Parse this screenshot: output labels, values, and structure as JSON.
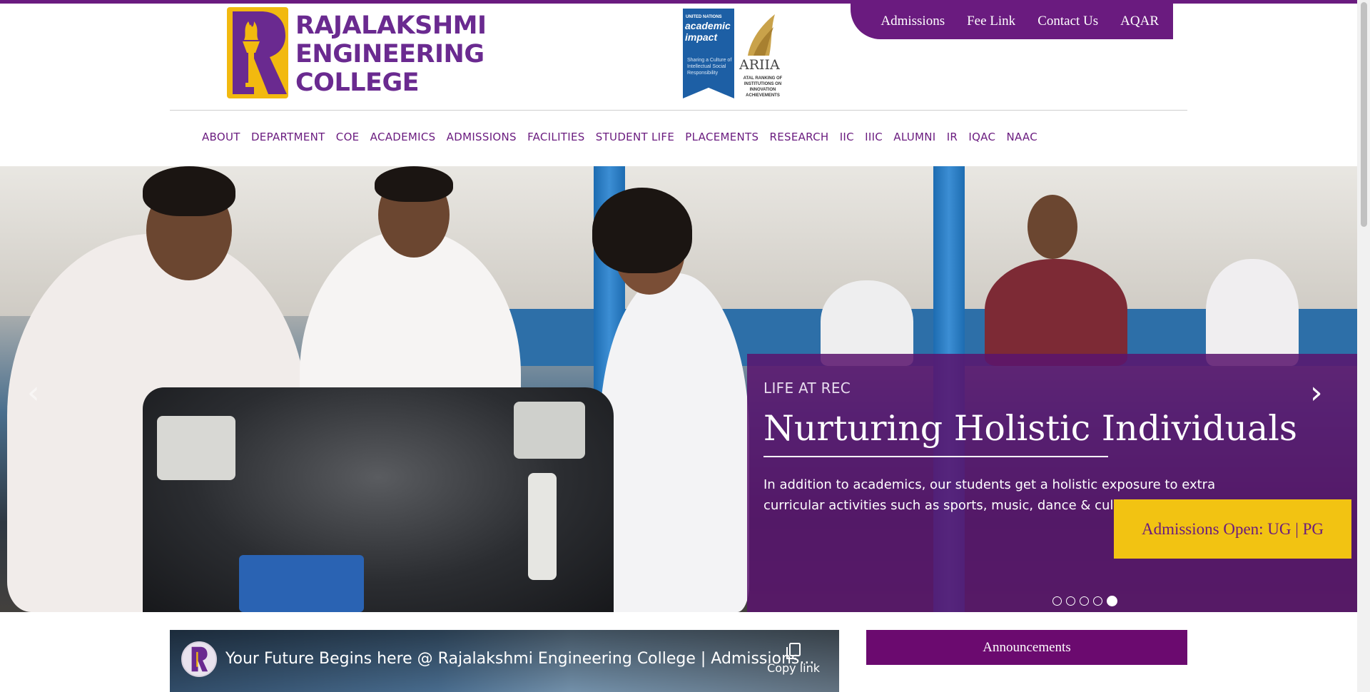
{
  "logo": {
    "line1": "RAJALAKSHMI",
    "line2": "ENGINEERING",
    "line3": "COLLEGE"
  },
  "partners": {
    "unai_line1": "UNITED NATIONS",
    "unai_line2": "academic impact",
    "unai_line3": "Sharing a Culture of Intellectual Social Responsibility",
    "ariia_name": "ARIIA",
    "ariia_desc": "ATAL RANKING OF INSTITUTIONS ON INNOVATION ACHIEVEMENTS"
  },
  "utility_nav": [
    "Admissions",
    "Fee Link",
    "Contact Us",
    "AQAR"
  ],
  "main_nav": [
    "ABOUT",
    "DEPARTMENT",
    "COE",
    "ACADEMICS",
    "ADMISSIONS",
    "FACILITIES",
    "STUDENT LIFE",
    "PLACEMENTS",
    "RESEARCH",
    "IIC",
    "IIIC",
    "ALUMNI",
    "IR",
    "IQAC",
    "NAAC"
  ],
  "hero": {
    "eyebrow": "LIFE AT REC",
    "title": "Nurturing Holistic Individuals",
    "body": "In addition to academics, our students get a holistic exposure to extra curricular activities such as sports, music, dance & cultural festivals.",
    "prev_glyph": "‹",
    "next_glyph": "›",
    "slides_total": 5,
    "active_slide": 5
  },
  "admissions_badge": "Admissions Open: UG | PG",
  "video": {
    "title": "Your Future Begins here @ Rajalakshmi Engineering College | Admissions...",
    "copy_label": "Copy link"
  },
  "announcements_title": "Announcements",
  "colors": {
    "brand_purple": "#6a1b7f",
    "accent_yellow": "#f2c312"
  }
}
